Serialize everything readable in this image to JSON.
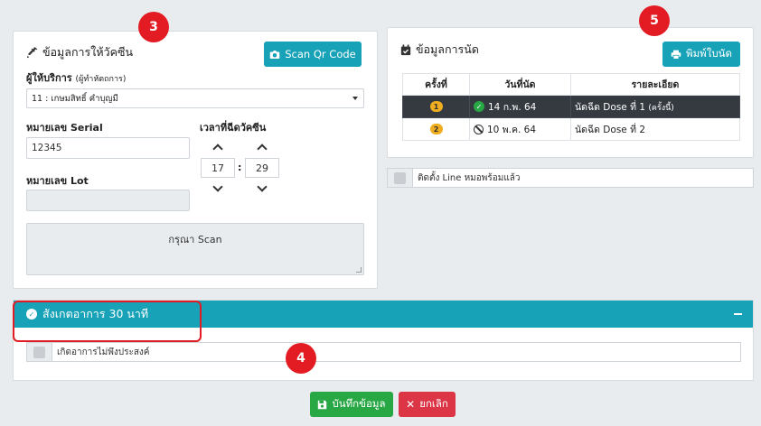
{
  "vaccination": {
    "title": "ข้อมูลการให้วัคซีน",
    "scan_button": "Scan Qr Code",
    "provider_label": "ผู้ให้บริการ",
    "provider_sub": "(ผู้ทำหัตถการ)",
    "provider_value": "11 : เกษมสิทธิ์ คำบุญมี",
    "serial_label": "หมายเลข Serial",
    "serial_value": "12345",
    "time_label": "เวลาที่ฉีดวัคซีน",
    "hour": "17",
    "minute": "29",
    "lot_label": "หมายเลข Lot",
    "lot_value": "",
    "scan_placeholder": "กรุณา Scan"
  },
  "appointment": {
    "title": "ข้อมูลการนัด",
    "print_button": "พิมพ์ใบนัด",
    "columns": [
      "ครั้งที่",
      "วันที่นัด",
      "รายละเอียด"
    ],
    "rows": [
      {
        "num": "1",
        "date": "14 ก.พ. 64",
        "detail": "นัดฉีด Dose ที่ 1",
        "detail_note": "(ครั้งนี้)",
        "status": "done"
      },
      {
        "num": "2",
        "date": "10 พ.ค. 64",
        "detail": "นัดฉีด Dose ที่ 2",
        "detail_note": "",
        "status": "cancelled"
      }
    ],
    "line_label": "ติดตั้ง Line หมอพร้อมแล้ว"
  },
  "observation": {
    "title": "สังเกตอาการ 30 นาที",
    "adverse_label": "เกิดอาการไม่พึงประสงค์"
  },
  "actions": {
    "save": "บันทึกข้อมูล",
    "cancel": "ยกเลิก"
  },
  "annotations": {
    "three": "3",
    "four": "4",
    "five": "5"
  },
  "colors": {
    "teal": "#17a2b8",
    "green": "#28a745",
    "red": "#dc3545",
    "annotation": "#e31b23"
  }
}
